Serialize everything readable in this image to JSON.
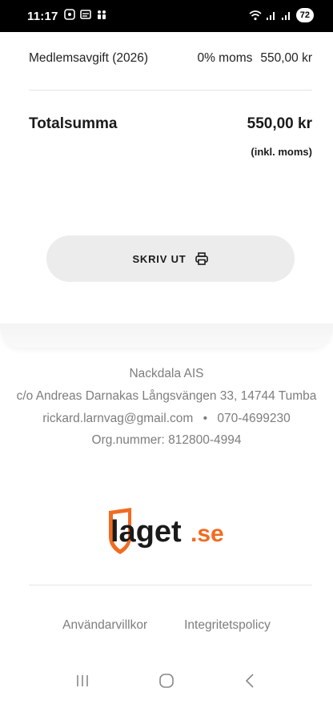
{
  "status_bar": {
    "time": "11:17",
    "battery": "72"
  },
  "line_item": {
    "description": "Medlemsavgift (2026)",
    "vat": "0% moms",
    "amount": "550,00 kr"
  },
  "total": {
    "label": "Totalsumma",
    "amount": "550,00 kr",
    "incl_note": "(inkl. moms)"
  },
  "print_button": {
    "label": "SKRIV UT",
    "icon": "printer-icon"
  },
  "organization": {
    "name": "Nackdala AIS",
    "address": "c/o Andreas Darnakas Långsvängen 33, 14744 Tumba",
    "email": "rickard.larnvag@gmail.com",
    "separator": "•",
    "phone": "070-4699230",
    "org_number": "Org.nummer: 812800-4994"
  },
  "logo": {
    "text_main": "laget",
    "text_suffix": ".se",
    "brand_color": "#f26b21",
    "dark_color": "#1a1a1a"
  },
  "footer_links": {
    "terms": "Användarvillkor",
    "privacy": "Integritetspolicy"
  },
  "nav_bar": {
    "icons": [
      "recent-apps-icon",
      "home-icon",
      "back-icon"
    ]
  }
}
